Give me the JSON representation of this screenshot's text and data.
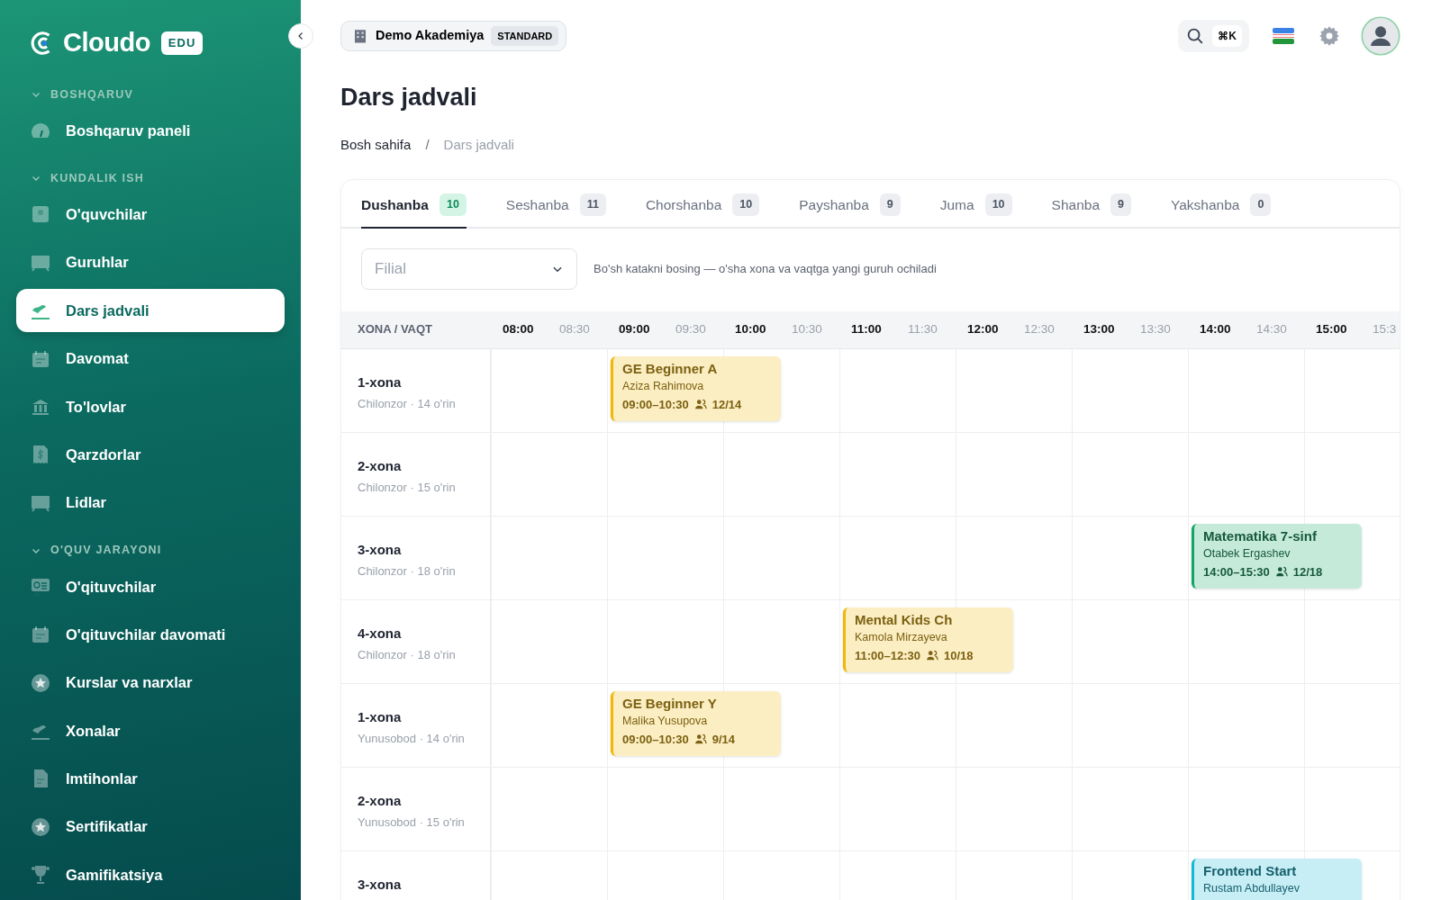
{
  "sidebar": {
    "logo": "Cloudo",
    "logo_badge": "EDU",
    "sections": [
      {
        "title": "BOSHQARUV",
        "expanded": true,
        "items": [
          {
            "label": "Boshqaruv paneli",
            "selected": false
          }
        ]
      },
      {
        "title": "KUNDALIK ISH",
        "expanded": true,
        "items": [
          {
            "label": "O'quvchilar",
            "selected": false
          },
          {
            "label": "Guruhlar",
            "selected": false
          },
          {
            "label": "Dars jadvali",
            "selected": true
          },
          {
            "label": "Davomat",
            "selected": false
          },
          {
            "label": "To'lovlar",
            "selected": false
          },
          {
            "label": "Qarzdorlar",
            "selected": false
          },
          {
            "label": "Lidlar",
            "selected": false
          }
        ]
      },
      {
        "title": "O'QUV JARAYONI",
        "expanded": true,
        "items": [
          {
            "label": "O'qituvchilar",
            "selected": false
          },
          {
            "label": "O'qituvchilar davomati",
            "selected": false
          },
          {
            "label": "Kurslar va narxlar",
            "selected": false
          },
          {
            "label": "Xonalar",
            "selected": false
          },
          {
            "label": "Imtihonlar",
            "selected": false
          },
          {
            "label": "Sertifikatlar",
            "selected": false
          },
          {
            "label": "Gamifikatsiya",
            "selected": false
          }
        ]
      }
    ]
  },
  "topbar": {
    "org": "Demo Akademiya",
    "plan": "STANDARD",
    "shortcut": "⌘K"
  },
  "page_title": "Dars jadvali",
  "breadcrumb": [
    "Bosh sahifa",
    "Dars jadvali"
  ],
  "breadcrumb_separator": "/",
  "tabs": [
    {
      "label": "Dushanba",
      "count": "10",
      "selected": true
    },
    {
      "label": "Seshanba",
      "count": "11",
      "selected": false
    },
    {
      "label": "Chorshanba",
      "count": "10",
      "selected": false
    },
    {
      "label": "Payshanba",
      "count": "9",
      "selected": false
    },
    {
      "label": "Juma",
      "count": "10",
      "selected": false
    },
    {
      "label": "Shanba",
      "count": "9",
      "selected": false
    },
    {
      "label": "Yakshanba",
      "count": "0",
      "selected": false
    }
  ],
  "filter": {
    "placeholder": "Filial",
    "hint": "Bo'sh katakni bosing — o'sha xona va vaqtga yangi guruh ochiladi"
  },
  "schedule": {
    "corner": "XONA / VAQT",
    "columns": [
      {
        "hour": "08:00",
        "half": "08:30"
      },
      {
        "hour": "09:00",
        "half": "09:30"
      },
      {
        "hour": "10:00",
        "half": "10:30"
      },
      {
        "hour": "11:00",
        "half": "11:30"
      },
      {
        "hour": "12:00",
        "half": "12:30"
      },
      {
        "hour": "13:00",
        "half": "13:30"
      },
      {
        "hour": "14:00",
        "half": "14:30"
      },
      {
        "hour": "15:00",
        "half": "15:3"
      }
    ],
    "rows": [
      {
        "room": "1-xona",
        "info": "Chilonzor · 14 o'rin",
        "cells": [
          null,
          {
            "title": "GE Beginner A",
            "teacher": "Aziza Rahimova",
            "time": "09:00–10:30",
            "seats": "12/14",
            "color": "#f2b705"
          },
          null,
          null,
          null,
          null,
          null,
          null
        ]
      },
      {
        "room": "2-xona",
        "info": "Chilonzor · 15 o'rin",
        "cells": [
          null,
          null,
          null,
          null,
          null,
          null,
          null,
          null
        ]
      },
      {
        "room": "3-xona",
        "info": "Chilonzor · 18 o'rin",
        "cells": [
          null,
          null,
          null,
          null,
          null,
          null,
          {
            "title": "Matematika 7-sinf",
            "teacher": "Otabek Ergashev",
            "time": "14:00–15:30",
            "seats": "12/18",
            "color": "#10a765"
          },
          null
        ]
      },
      {
        "room": "4-xona",
        "info": "Chilonzor · 18 o'rin",
        "cells": [
          null,
          null,
          null,
          {
            "title": "Mental Kids Ch",
            "teacher": "Kamola Mirzayeva",
            "time": "11:00–12:30",
            "seats": "10/18",
            "color": "#f2b705"
          },
          null,
          null,
          null,
          null
        ]
      },
      {
        "room": "1-xona",
        "info": "Yunusobod · 14 o'rin",
        "cells": [
          null,
          {
            "title": "GE Beginner Y",
            "teacher": "Malika Yusupova",
            "time": "09:00–10:30",
            "seats": "9/14",
            "color": "#f2b705"
          },
          null,
          null,
          null,
          null,
          null,
          null
        ]
      },
      {
        "room": "2-xona",
        "info": "Yunusobod · 15 o'rin",
        "cells": [
          null,
          null,
          null,
          null,
          null,
          null,
          null,
          null
        ]
      },
      {
        "room": "3-xona",
        "cells": [
          null,
          null,
          null,
          null,
          null,
          null,
          {
            "title": "Frontend Start",
            "teacher": "Rustam Abdullayev",
            "color": "#14b8d4"
          },
          null
        ]
      }
    ]
  }
}
